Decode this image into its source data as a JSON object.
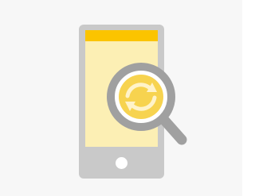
{
  "illustration": {
    "icon_name": "phone-refresh-search-icon",
    "parts": {
      "phone": "smartphone-icon",
      "status_bar": "phone-status-bar",
      "screen": "phone-screen",
      "home_button": "home-button-icon",
      "magnifier": "magnifying-glass-icon",
      "refresh": "refresh-arrows-icon"
    },
    "colors": {
      "background": "#f7f7f7",
      "phone_body": "#c9c9c9",
      "screen": "#fcefb4",
      "status_bar": "#fbc400",
      "home_button": "#ffffff",
      "magnifier_ring": "#a0a0a0",
      "magnifier_handle": "#a0a0a0",
      "lens_fill": "#f7d34f",
      "refresh_arrows": "#fff3c9"
    }
  }
}
